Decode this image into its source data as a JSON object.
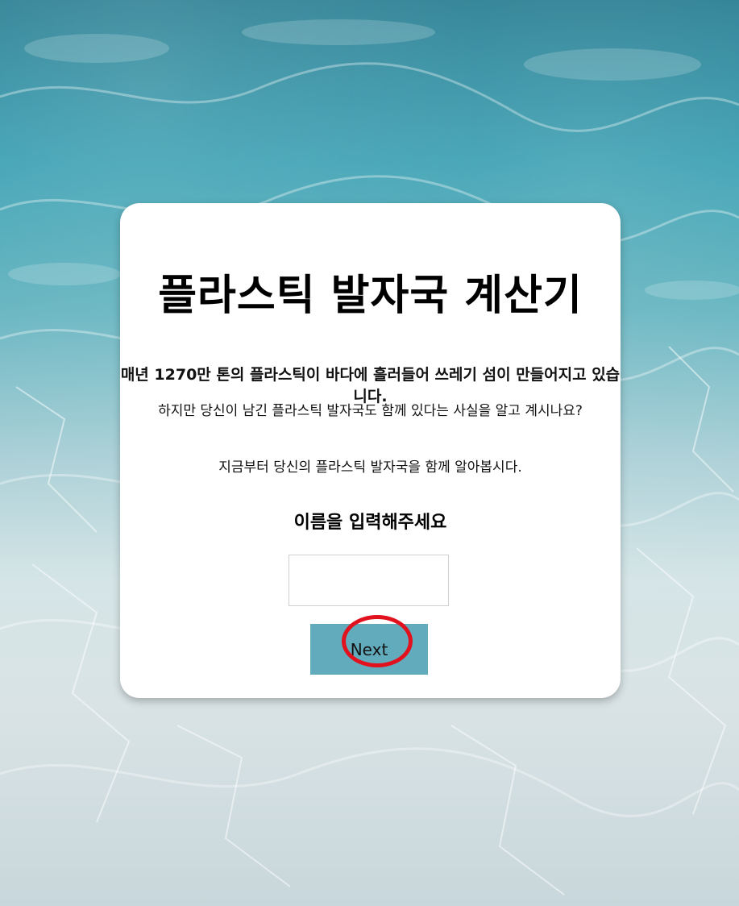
{
  "app": {
    "title": "플라스틱 발자국 계산기"
  },
  "intro": {
    "line1": "매년 1270만 톤의 플라스틱이 바다에 흘러들어 쓰레기 섬이 만들어지고 있습니다.",
    "line2": "하지만 당신이 남긴 플라스틱 발자국도 함께 있다는 사실을 알고 계시나요?",
    "line3": "지금부터 당신의 플라스틱 발자국을 함께 알아봅시다."
  },
  "form": {
    "name_label": "이름을 입력해주세요",
    "name_value": "",
    "next_label": "Next"
  },
  "colors": {
    "button_bg": "#62abbd",
    "highlight": "#e1121e",
    "card_bg": "#ffffff"
  }
}
